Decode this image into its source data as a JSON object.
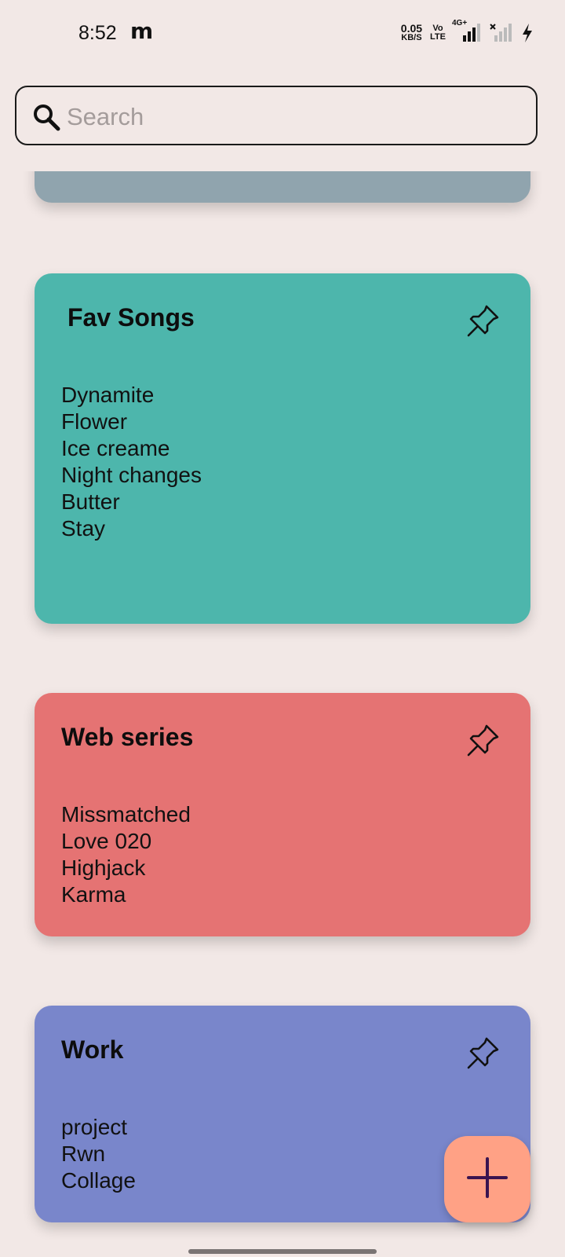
{
  "status_bar": {
    "time": "8:52",
    "app_icon_letter": "m",
    "net_speed_value": "0.05",
    "net_speed_unit": "KB/S",
    "volte_top": "Vo",
    "volte_bottom": "LTE",
    "network_type": "4G+"
  },
  "search": {
    "placeholder": "Search",
    "value": ""
  },
  "notes": [
    {
      "title": "",
      "body": "",
      "color": "#90a4ae"
    },
    {
      "title": "Fav Songs",
      "body": "Dynamite\nFlower\nIce creame\nNight changes\nButter\nStay",
      "color": "#4db6ac"
    },
    {
      "title": "Web series",
      "body": "Missmatched\nLove 020\nHighjack\nKarma",
      "color": "#e57373"
    },
    {
      "title": "Work",
      "body": "project\nRwn\nCollage",
      "color": "#7986cb"
    }
  ],
  "fab": {
    "icon": "plus-icon",
    "color": "#ffa185"
  },
  "colors": {
    "background": "#f2e8e6",
    "icon": "#111111"
  }
}
